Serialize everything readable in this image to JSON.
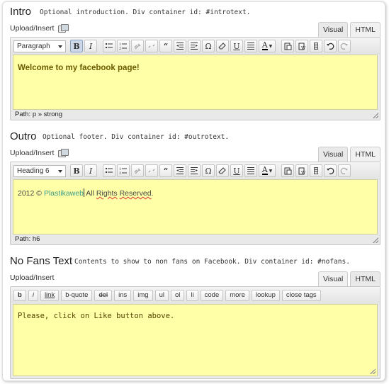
{
  "sections": [
    {
      "title": "Intro",
      "description": "Optional introduction. Div container id: #introtext.",
      "upload_label": "Upload/Insert",
      "tabs": [
        "Visual",
        "HTML"
      ],
      "format_value": "Paragraph",
      "content": "Welcome to my facebook page!",
      "path_label": "Path:",
      "path_value": "p » strong"
    },
    {
      "title": "Outro",
      "description": "Optional footer. Div container id: #outrotext.",
      "upload_label": "Upload/Insert",
      "tabs": [
        "Visual",
        "HTML"
      ],
      "format_value": "Heading 6",
      "content_prefix": "2012 © ",
      "content_link": "Plastikaweb",
      "content_mid": " All ",
      "content_w1": "Rights",
      "content_sp": " ",
      "content_w2": "Reserved",
      "content_end": ".",
      "path_label": "Path:",
      "path_value": "h6"
    },
    {
      "title": "No Fans Text",
      "description": "Contents to show to non fans on Facebook. Div container id: #nofans.",
      "upload_label": "Upload/Insert",
      "tabs": [
        "Visual",
        "HTML"
      ],
      "quicktags": [
        "b",
        "i",
        "link",
        "b-quote",
        "del",
        "ins",
        "img",
        "ul",
        "ol",
        "li",
        "code",
        "more",
        "lookup",
        "close tags"
      ],
      "content": "Please, click on Like button above."
    }
  ]
}
